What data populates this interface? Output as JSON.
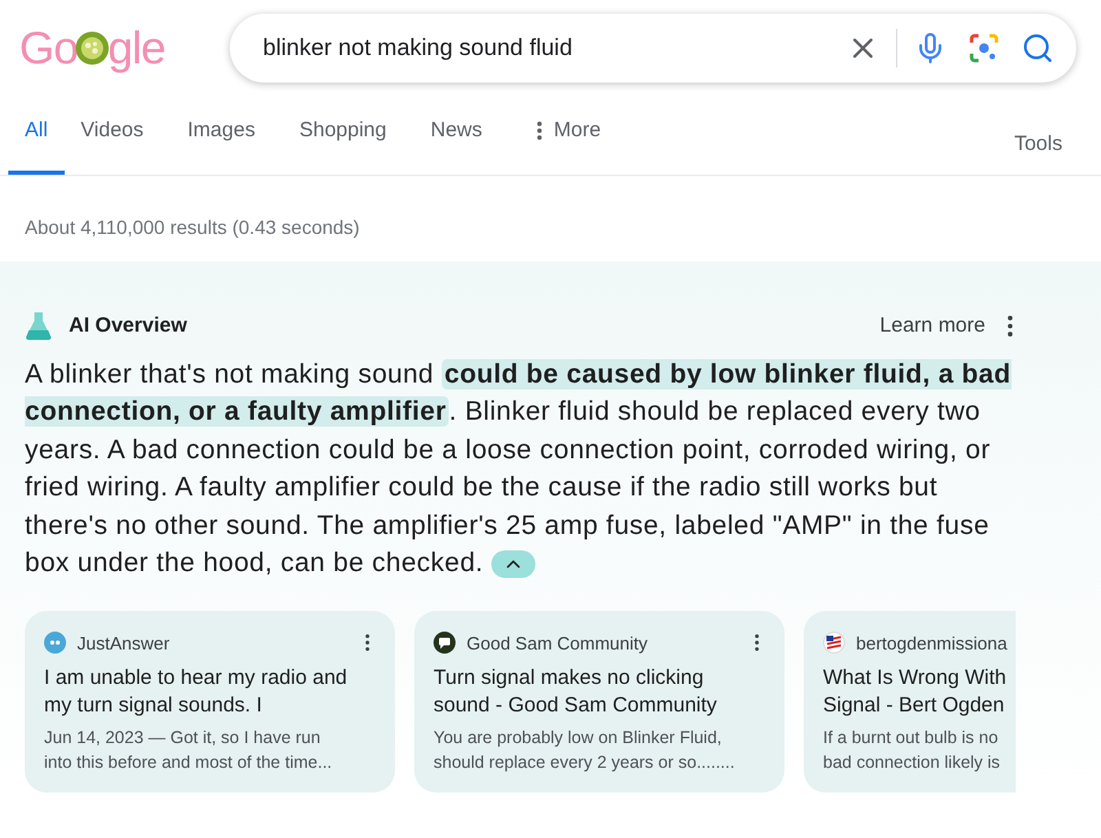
{
  "logo": {
    "left": "Go",
    "right": "gle"
  },
  "search": {
    "value": "blinker not making sound fluid"
  },
  "tabs": [
    {
      "label": "All",
      "selected": true,
      "kind": "tab"
    },
    {
      "label": "Videos",
      "selected": false,
      "kind": "tab"
    },
    {
      "label": "Images",
      "selected": false,
      "kind": "tab"
    },
    {
      "label": "Shopping",
      "selected": false,
      "kind": "tab"
    },
    {
      "label": "News",
      "selected": false,
      "kind": "tab"
    },
    {
      "label": "More",
      "selected": false,
      "kind": "menu"
    }
  ],
  "tools": "Tools",
  "result_stats": "About 4,110,000 results (0.43 seconds)",
  "ai_overview": {
    "title": "AI Overview",
    "learn_more": "Learn more",
    "text_before": "A blinker that's not making sound ",
    "highlight": "could be caused by low blinker fluid, a bad connection, or a faulty amplifier",
    "text_after": ". Blinker fluid should be replaced every two years. A bad connection could be a loose connection point, corroded wiring, or fried wiring. A faulty amplifier could be the cause if the radio still works but there's no other sound. The amplifier's 25 amp fuse, labeled \"AMP\" in the fuse box under the hood, can be checked.",
    "expanded": true
  },
  "sources": [
    {
      "site": "JustAnswer",
      "kind": "justanswer",
      "title": [
        "I am unable to hear my radio and",
        "my turn signal sounds. I"
      ],
      "snippet": [
        "Jun 14, 2023 — Got it, so I have run",
        "into this before and most of the time..."
      ],
      "menu": true
    },
    {
      "site": "Good Sam Community",
      "kind": "goodsam",
      "title": [
        "Turn signal makes no clicking",
        "sound - Good Sam Community"
      ],
      "snippet": [
        "You are probably low on Blinker Fluid,",
        "should replace every 2 years or so........"
      ],
      "menu": true
    },
    {
      "site": "bertogdenmissiona",
      "kind": "flag",
      "title": [
        "What Is Wrong With",
        "Signal - Bert Ogden"
      ],
      "snippet": [
        "If a burnt out bulb is no",
        "bad connection likely is"
      ]
    }
  ]
}
